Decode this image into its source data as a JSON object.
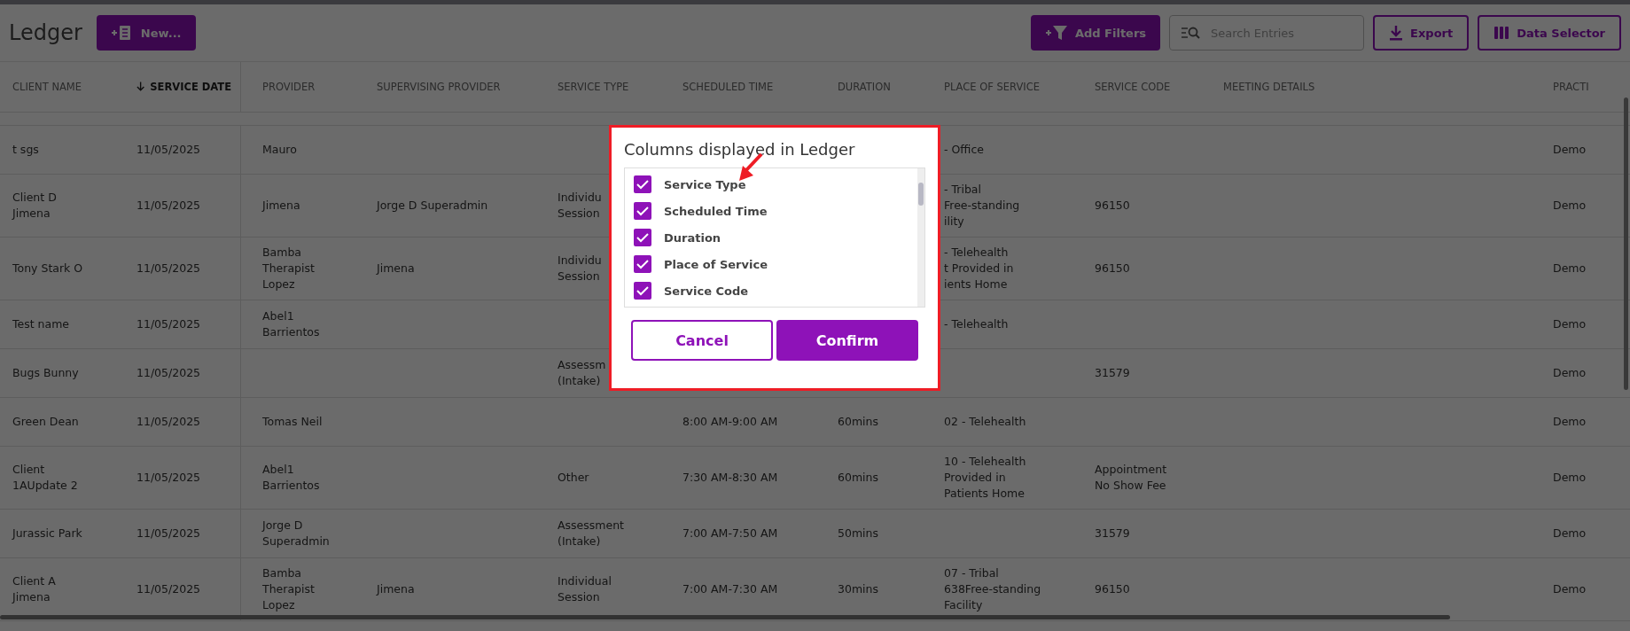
{
  "page": {
    "title": "Ledger"
  },
  "toolbar": {
    "new_button": "New...",
    "filter_button": "Add Filters",
    "search": {
      "placeholder": "Search Entries"
    },
    "export_button": "Export",
    "selector_button": "Data Selector"
  },
  "table": {
    "columns": [
      {
        "label": "CLIENT NAME",
        "sorted": false
      },
      {
        "label": "SERVICE DATE",
        "sorted": true
      },
      {
        "label": "PROVIDER",
        "sorted": false
      },
      {
        "label": "SUPERVISING PROVIDER",
        "sorted": false
      },
      {
        "label": "SERVICE TYPE",
        "sorted": false
      },
      {
        "label": "SCHEDULED TIME",
        "sorted": false
      },
      {
        "label": "DURATION",
        "sorted": false
      },
      {
        "label": "PLACE OF SERVICE",
        "sorted": false
      },
      {
        "label": "SERVICE CODE",
        "sorted": false
      },
      {
        "label": "MEETING DETAILS",
        "sorted": false
      },
      {
        "label": "PRACTI",
        "sorted": false
      }
    ],
    "rows": [
      [
        "t sgs",
        "11/05/2025",
        "Mauro",
        null,
        null,
        null,
        null,
        "- Office",
        null,
        null,
        "Demo"
      ],
      [
        "Client D\nJimena",
        "11/05/2025",
        "Jimena",
        "Jorge D Superadmin",
        "Individu\nSession",
        null,
        null,
        "- Tribal\nFree-standing\nility",
        "96150",
        null,
        "Demo"
      ],
      [
        "Tony Stark O",
        "11/05/2025",
        "Bamba\nTherapist\nLopez",
        "Jimena",
        "Individu\nSession",
        null,
        null,
        "- Telehealth\nt Provided in\nients Home",
        "96150",
        null,
        "Demo"
      ],
      [
        "Test name",
        "11/05/2025",
        "Abel1\nBarrientos",
        null,
        null,
        null,
        null,
        "- Telehealth",
        null,
        null,
        "Demo"
      ],
      [
        "Bugs Bunny",
        "11/05/2025",
        null,
        null,
        "Assessm\n(Intake)",
        null,
        null,
        null,
        "31579",
        null,
        "Demo"
      ],
      [
        "Green Dean",
        "11/05/2025",
        "Tomas Neil",
        null,
        null,
        "8:00 AM-9:00 AM",
        "60mins",
        "02 - Telehealth",
        null,
        null,
        "Demo"
      ],
      [
        "Client\n1AUpdate 2",
        "11/05/2025",
        "Abel1\nBarrientos",
        null,
        "Other",
        "7:30 AM-8:30 AM",
        "60mins",
        "10 - Telehealth\nProvided in\nPatients Home",
        "Appointment\nNo Show Fee",
        null,
        "Demo"
      ],
      [
        "Jurassic Park",
        "11/05/2025",
        "Jorge D\nSuperadmin",
        null,
        "Assessment\n(Intake)",
        "7:00 AM-7:50 AM",
        "50mins",
        null,
        "31579",
        null,
        "Demo"
      ],
      [
        "Client A\nJimena",
        "11/05/2025",
        "Bamba\nTherapist\nLopez",
        "Jimena",
        "Individual\nSession",
        "7:00 AM-7:30 AM",
        "30mins",
        "07 - Tribal\n638Free-standing\nFacility",
        "96150",
        null,
        "Demo"
      ]
    ]
  },
  "dialog": {
    "title": "Columns displayed in Ledger",
    "options": [
      {
        "label": "Service Type",
        "checked": true
      },
      {
        "label": "Scheduled Time",
        "checked": true
      },
      {
        "label": "Duration",
        "checked": true
      },
      {
        "label": "Place of Service",
        "checked": true
      },
      {
        "label": "Service Code",
        "checked": true
      }
    ],
    "cancel_button": "Cancel",
    "confirm_button": "Confirm"
  }
}
